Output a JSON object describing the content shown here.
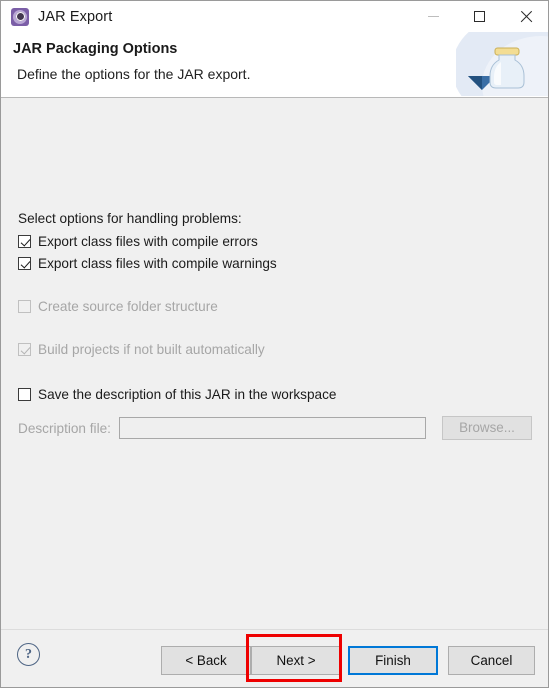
{
  "window": {
    "title": "JAR Export",
    "app_icon": "jar-export-icon",
    "controls": {
      "minimize": "minimize-icon",
      "maximize": "maximize-icon",
      "close": "close-icon"
    }
  },
  "header": {
    "title": "JAR Packaging Options",
    "subtitle": "Define the options for the JAR export.",
    "artwork": "jar-bottle-export-icon"
  },
  "content": {
    "intro_label": "Select options for handling problems:",
    "options": [
      {
        "label": "Export class files with compile errors",
        "checked": true,
        "disabled": false
      },
      {
        "label": "Export class files with compile warnings",
        "checked": true,
        "disabled": false
      },
      {
        "label": "Create source folder structure",
        "checked": false,
        "disabled": true
      },
      {
        "label": "Build projects if not built automatically",
        "checked": true,
        "disabled": true
      },
      {
        "label": "Save the description of this JAR in the workspace",
        "checked": false,
        "disabled": false
      }
    ],
    "description_file": {
      "label": "Description file:",
      "value": "",
      "placeholder": "",
      "browse_label": "Browse...",
      "disabled": true
    }
  },
  "footer": {
    "help": "?",
    "buttons": {
      "back": "< Back",
      "next": "Next >",
      "finish": "Finish",
      "cancel": "Cancel"
    }
  },
  "colors": {
    "accent_focus": "#0078d7",
    "annotation": "#ee0000",
    "dialog_bg": "#f0f0f0",
    "header_bg": "#ffffff",
    "title_icon": "#7b5ea7"
  }
}
